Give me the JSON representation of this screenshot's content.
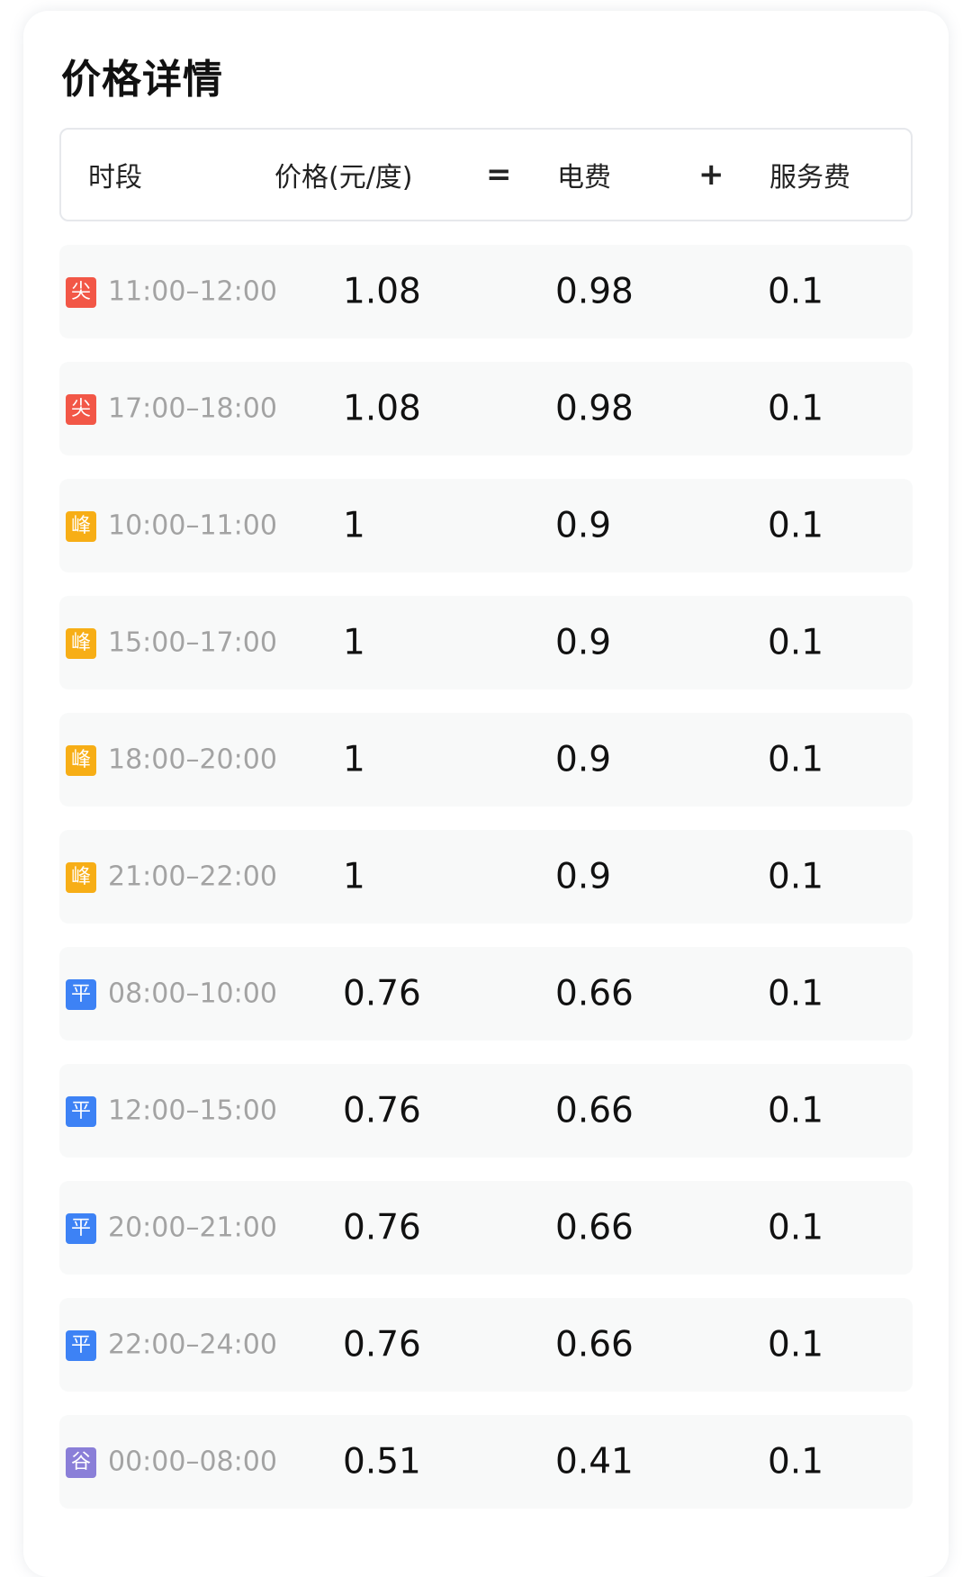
{
  "title": "价格详情",
  "header": {
    "period": "时段",
    "price": "价格(元/度)",
    "equals": "=",
    "electricity": "电费",
    "plus": "+",
    "service": "服务费"
  },
  "tier_colors": {
    "尖": "#f25747",
    "峰": "#f7ae16",
    "平": "#3d82f5",
    "谷": "#8a7fd8"
  },
  "rows": [
    {
      "tier": "尖",
      "time": "11:00–12:00",
      "price": "1.08",
      "electricity": "0.98",
      "service": "0.1"
    },
    {
      "tier": "尖",
      "time": "17:00–18:00",
      "price": "1.08",
      "electricity": "0.98",
      "service": "0.1"
    },
    {
      "tier": "峰",
      "time": "10:00–11:00",
      "price": "1",
      "electricity": "0.9",
      "service": "0.1"
    },
    {
      "tier": "峰",
      "time": "15:00–17:00",
      "price": "1",
      "electricity": "0.9",
      "service": "0.1"
    },
    {
      "tier": "峰",
      "time": "18:00–20:00",
      "price": "1",
      "electricity": "0.9",
      "service": "0.1"
    },
    {
      "tier": "峰",
      "time": "21:00–22:00",
      "price": "1",
      "electricity": "0.9",
      "service": "0.1"
    },
    {
      "tier": "平",
      "time": "08:00–10:00",
      "price": "0.76",
      "electricity": "0.66",
      "service": "0.1"
    },
    {
      "tier": "平",
      "time": "12:00–15:00",
      "price": "0.76",
      "electricity": "0.66",
      "service": "0.1"
    },
    {
      "tier": "平",
      "time": "20:00–21:00",
      "price": "0.76",
      "electricity": "0.66",
      "service": "0.1"
    },
    {
      "tier": "平",
      "time": "22:00–24:00",
      "price": "0.76",
      "electricity": "0.66",
      "service": "0.1"
    },
    {
      "tier": "谷",
      "time": "00:00–08:00",
      "price": "0.51",
      "electricity": "0.41",
      "service": "0.1"
    }
  ]
}
